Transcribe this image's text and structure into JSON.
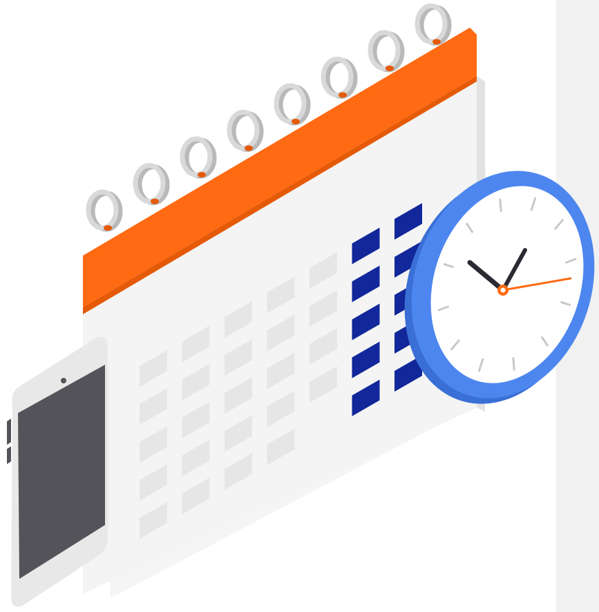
{
  "illustration": {
    "subject": "calendar-clock-phone",
    "colors": {
      "background": "#ffffff",
      "right_panel": "#f1f1f1",
      "calendar_header": "#ff6a13",
      "calendar_header_side": "#e55a08",
      "calendar_body": "#f4f4f4",
      "calendar_cell": "#e6e6e6",
      "highlight_cell": "#11279a",
      "spiral": "#d9d9d9",
      "spiral_shadow": "#b9b9b9",
      "clock_rim": "#4d86ee",
      "clock_rim_dark": "#3a6fd6",
      "clock_face": "#ffffff",
      "clock_hands": "#2b2a33",
      "second_hand": "#ff6a13",
      "phone_body": "#e8e8e8",
      "phone_screen": "#55535a"
    },
    "icons": [
      "calendar-icon",
      "clock-icon",
      "smartphone-icon"
    ]
  }
}
